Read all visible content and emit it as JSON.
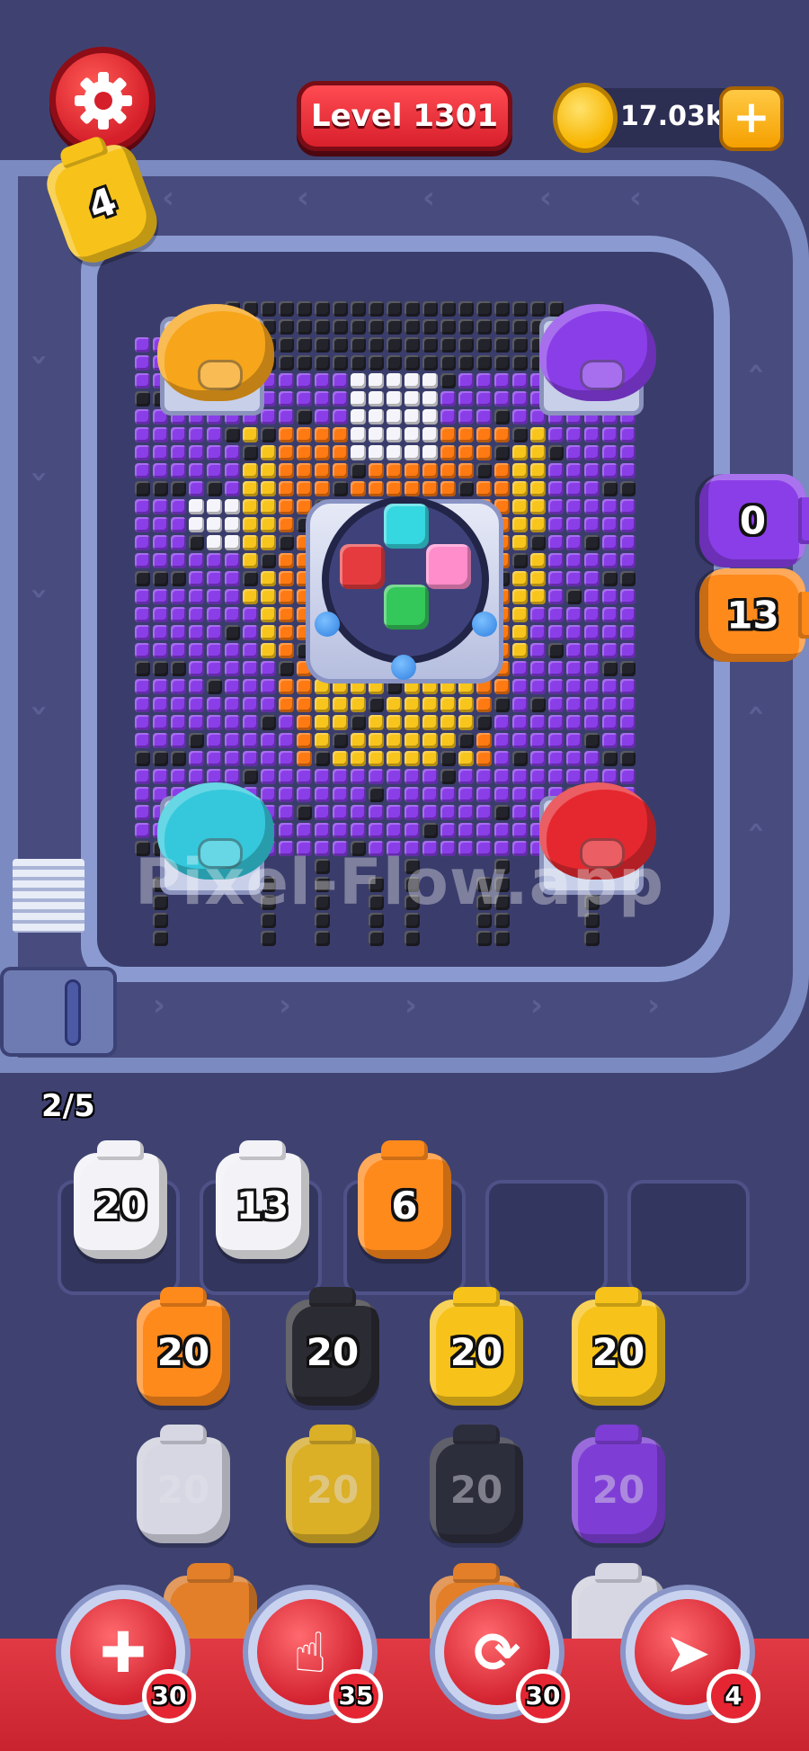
{
  "top_bar": {
    "level_label": "Level 1301",
    "coins": "17.03k",
    "coin_plus": "+"
  },
  "capacity": "2/5",
  "watermark": "Pixel-Flow.app",
  "track_pigs": [
    {
      "count": "4",
      "color": "#f7c31a"
    },
    {
      "count": "0",
      "color": "#8a3ee8"
    },
    {
      "count": "13",
      "color": "#ff8a1c"
    }
  ],
  "queue_slots": [
    {
      "count": "20",
      "color": "#f2f2f7"
    },
    {
      "count": "13",
      "color": "#f2f2f7"
    },
    {
      "count": "6",
      "color": "#ff8a1c"
    },
    {
      "count": "",
      "color": ""
    },
    {
      "count": "",
      "color": ""
    }
  ],
  "pig_rows": [
    [
      {
        "count": "20",
        "color": "#ff8a1c"
      },
      {
        "count": "20",
        "color": "#2b2b33"
      },
      {
        "count": "20",
        "color": "#f7c31a"
      },
      {
        "count": "20",
        "color": "#f7c31a"
      }
    ],
    [
      {
        "count": "20",
        "color": "#f2f2f7"
      },
      {
        "count": "20",
        "color": "#f7c31a"
      },
      {
        "count": "20",
        "color": "#2b2b33"
      },
      {
        "count": "20",
        "color": "#8a3ee8"
      }
    ]
  ],
  "boosters": [
    {
      "name": "add-slot",
      "count": "30"
    },
    {
      "name": "hand",
      "count": "35"
    },
    {
      "name": "shuffle",
      "count": "30"
    },
    {
      "name": "pig-launch",
      "count": "4"
    }
  ],
  "center_colors": [
    "#35d7e0",
    "#e53b3f",
    "#ff8ccb",
    "#34c75a"
  ],
  "corner_pigs": [
    {
      "color": "#f7a51b"
    },
    {
      "color": "#8a3ee8"
    },
    {
      "color": "#35c8dc"
    },
    {
      "color": "#e5282f"
    }
  ],
  "palette": {
    "purple": "#8a3ee8",
    "orange": "#ff7a12",
    "yellow": "#f8c51d",
    "white": "#f4f4fa",
    "black": "#23232b",
    "brand_red": "#d8202c"
  }
}
